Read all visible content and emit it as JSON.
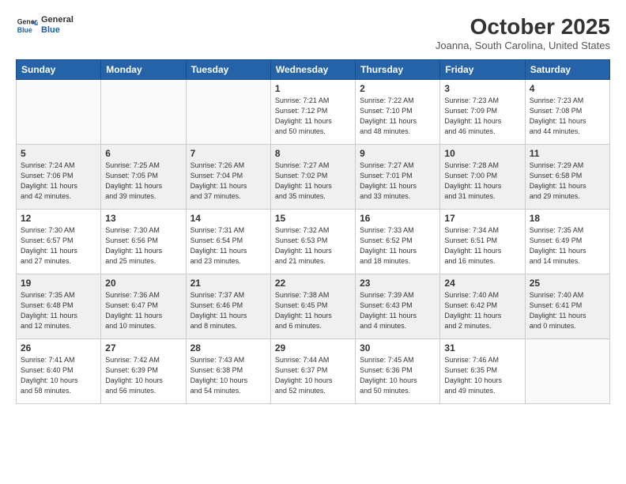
{
  "header": {
    "logo_line1": "General",
    "logo_line2": "Blue",
    "title": "October 2025",
    "location": "Joanna, South Carolina, United States"
  },
  "days_of_week": [
    "Sunday",
    "Monday",
    "Tuesday",
    "Wednesday",
    "Thursday",
    "Friday",
    "Saturday"
  ],
  "weeks": [
    [
      {
        "day": "",
        "info": ""
      },
      {
        "day": "",
        "info": ""
      },
      {
        "day": "",
        "info": ""
      },
      {
        "day": "1",
        "info": "Sunrise: 7:21 AM\nSunset: 7:12 PM\nDaylight: 11 hours\nand 50 minutes."
      },
      {
        "day": "2",
        "info": "Sunrise: 7:22 AM\nSunset: 7:10 PM\nDaylight: 11 hours\nand 48 minutes."
      },
      {
        "day": "3",
        "info": "Sunrise: 7:23 AM\nSunset: 7:09 PM\nDaylight: 11 hours\nand 46 minutes."
      },
      {
        "day": "4",
        "info": "Sunrise: 7:23 AM\nSunset: 7:08 PM\nDaylight: 11 hours\nand 44 minutes."
      }
    ],
    [
      {
        "day": "5",
        "info": "Sunrise: 7:24 AM\nSunset: 7:06 PM\nDaylight: 11 hours\nand 42 minutes."
      },
      {
        "day": "6",
        "info": "Sunrise: 7:25 AM\nSunset: 7:05 PM\nDaylight: 11 hours\nand 39 minutes."
      },
      {
        "day": "7",
        "info": "Sunrise: 7:26 AM\nSunset: 7:04 PM\nDaylight: 11 hours\nand 37 minutes."
      },
      {
        "day": "8",
        "info": "Sunrise: 7:27 AM\nSunset: 7:02 PM\nDaylight: 11 hours\nand 35 minutes."
      },
      {
        "day": "9",
        "info": "Sunrise: 7:27 AM\nSunset: 7:01 PM\nDaylight: 11 hours\nand 33 minutes."
      },
      {
        "day": "10",
        "info": "Sunrise: 7:28 AM\nSunset: 7:00 PM\nDaylight: 11 hours\nand 31 minutes."
      },
      {
        "day": "11",
        "info": "Sunrise: 7:29 AM\nSunset: 6:58 PM\nDaylight: 11 hours\nand 29 minutes."
      }
    ],
    [
      {
        "day": "12",
        "info": "Sunrise: 7:30 AM\nSunset: 6:57 PM\nDaylight: 11 hours\nand 27 minutes."
      },
      {
        "day": "13",
        "info": "Sunrise: 7:30 AM\nSunset: 6:56 PM\nDaylight: 11 hours\nand 25 minutes."
      },
      {
        "day": "14",
        "info": "Sunrise: 7:31 AM\nSunset: 6:54 PM\nDaylight: 11 hours\nand 23 minutes."
      },
      {
        "day": "15",
        "info": "Sunrise: 7:32 AM\nSunset: 6:53 PM\nDaylight: 11 hours\nand 21 minutes."
      },
      {
        "day": "16",
        "info": "Sunrise: 7:33 AM\nSunset: 6:52 PM\nDaylight: 11 hours\nand 18 minutes."
      },
      {
        "day": "17",
        "info": "Sunrise: 7:34 AM\nSunset: 6:51 PM\nDaylight: 11 hours\nand 16 minutes."
      },
      {
        "day": "18",
        "info": "Sunrise: 7:35 AM\nSunset: 6:49 PM\nDaylight: 11 hours\nand 14 minutes."
      }
    ],
    [
      {
        "day": "19",
        "info": "Sunrise: 7:35 AM\nSunset: 6:48 PM\nDaylight: 11 hours\nand 12 minutes."
      },
      {
        "day": "20",
        "info": "Sunrise: 7:36 AM\nSunset: 6:47 PM\nDaylight: 11 hours\nand 10 minutes."
      },
      {
        "day": "21",
        "info": "Sunrise: 7:37 AM\nSunset: 6:46 PM\nDaylight: 11 hours\nand 8 minutes."
      },
      {
        "day": "22",
        "info": "Sunrise: 7:38 AM\nSunset: 6:45 PM\nDaylight: 11 hours\nand 6 minutes."
      },
      {
        "day": "23",
        "info": "Sunrise: 7:39 AM\nSunset: 6:43 PM\nDaylight: 11 hours\nand 4 minutes."
      },
      {
        "day": "24",
        "info": "Sunrise: 7:40 AM\nSunset: 6:42 PM\nDaylight: 11 hours\nand 2 minutes."
      },
      {
        "day": "25",
        "info": "Sunrise: 7:40 AM\nSunset: 6:41 PM\nDaylight: 11 hours\nand 0 minutes."
      }
    ],
    [
      {
        "day": "26",
        "info": "Sunrise: 7:41 AM\nSunset: 6:40 PM\nDaylight: 10 hours\nand 58 minutes."
      },
      {
        "day": "27",
        "info": "Sunrise: 7:42 AM\nSunset: 6:39 PM\nDaylight: 10 hours\nand 56 minutes."
      },
      {
        "day": "28",
        "info": "Sunrise: 7:43 AM\nSunset: 6:38 PM\nDaylight: 10 hours\nand 54 minutes."
      },
      {
        "day": "29",
        "info": "Sunrise: 7:44 AM\nSunset: 6:37 PM\nDaylight: 10 hours\nand 52 minutes."
      },
      {
        "day": "30",
        "info": "Sunrise: 7:45 AM\nSunset: 6:36 PM\nDaylight: 10 hours\nand 50 minutes."
      },
      {
        "day": "31",
        "info": "Sunrise: 7:46 AM\nSunset: 6:35 PM\nDaylight: 10 hours\nand 49 minutes."
      },
      {
        "day": "",
        "info": ""
      }
    ]
  ]
}
